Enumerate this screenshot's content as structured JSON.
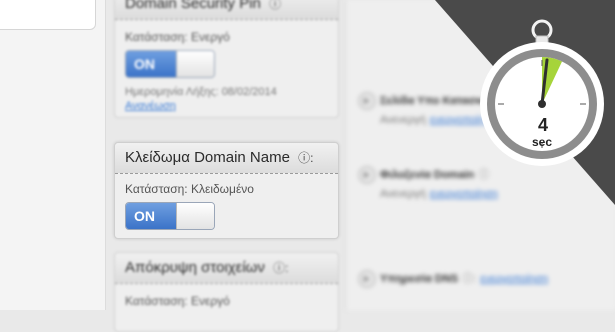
{
  "colors": {
    "accent": "#3b73c8",
    "timer_progress": "#a6d43a",
    "corner": "#4a4a4a"
  },
  "panel_top": {
    "title": "Domain Security Pin",
    "status": "Κατάσταση: Ενεργό",
    "toggle": "ON",
    "expiry": "Ημερομηνία Λήξης: 08/02/2014",
    "link": "Ανανέωση"
  },
  "panel_main": {
    "title": "Κλείδωμα Domain Name",
    "status": "Κατάσταση: Κλειδωμένο",
    "toggle": "ON"
  },
  "panel_bottom": {
    "title": "Απόκρυψη στοιχείων",
    "status": "Κατάσταση: Ενεργό"
  },
  "right_items": [
    {
      "title": "Σελίδα Υπο Κατασκευή",
      "desc": "Ανενεργή",
      "link": "ενεργοποίηση"
    },
    {
      "title": "Φιλοξενία Domain",
      "desc": "Ανενεργή",
      "link": "ενεργοποίηση"
    },
    {
      "title": "Υπηρεσία DNS",
      "desc": "",
      "link": "ενεργοποίηση"
    }
  ],
  "timer": {
    "value": "4",
    "unit": "sec",
    "progress": 0.07
  }
}
